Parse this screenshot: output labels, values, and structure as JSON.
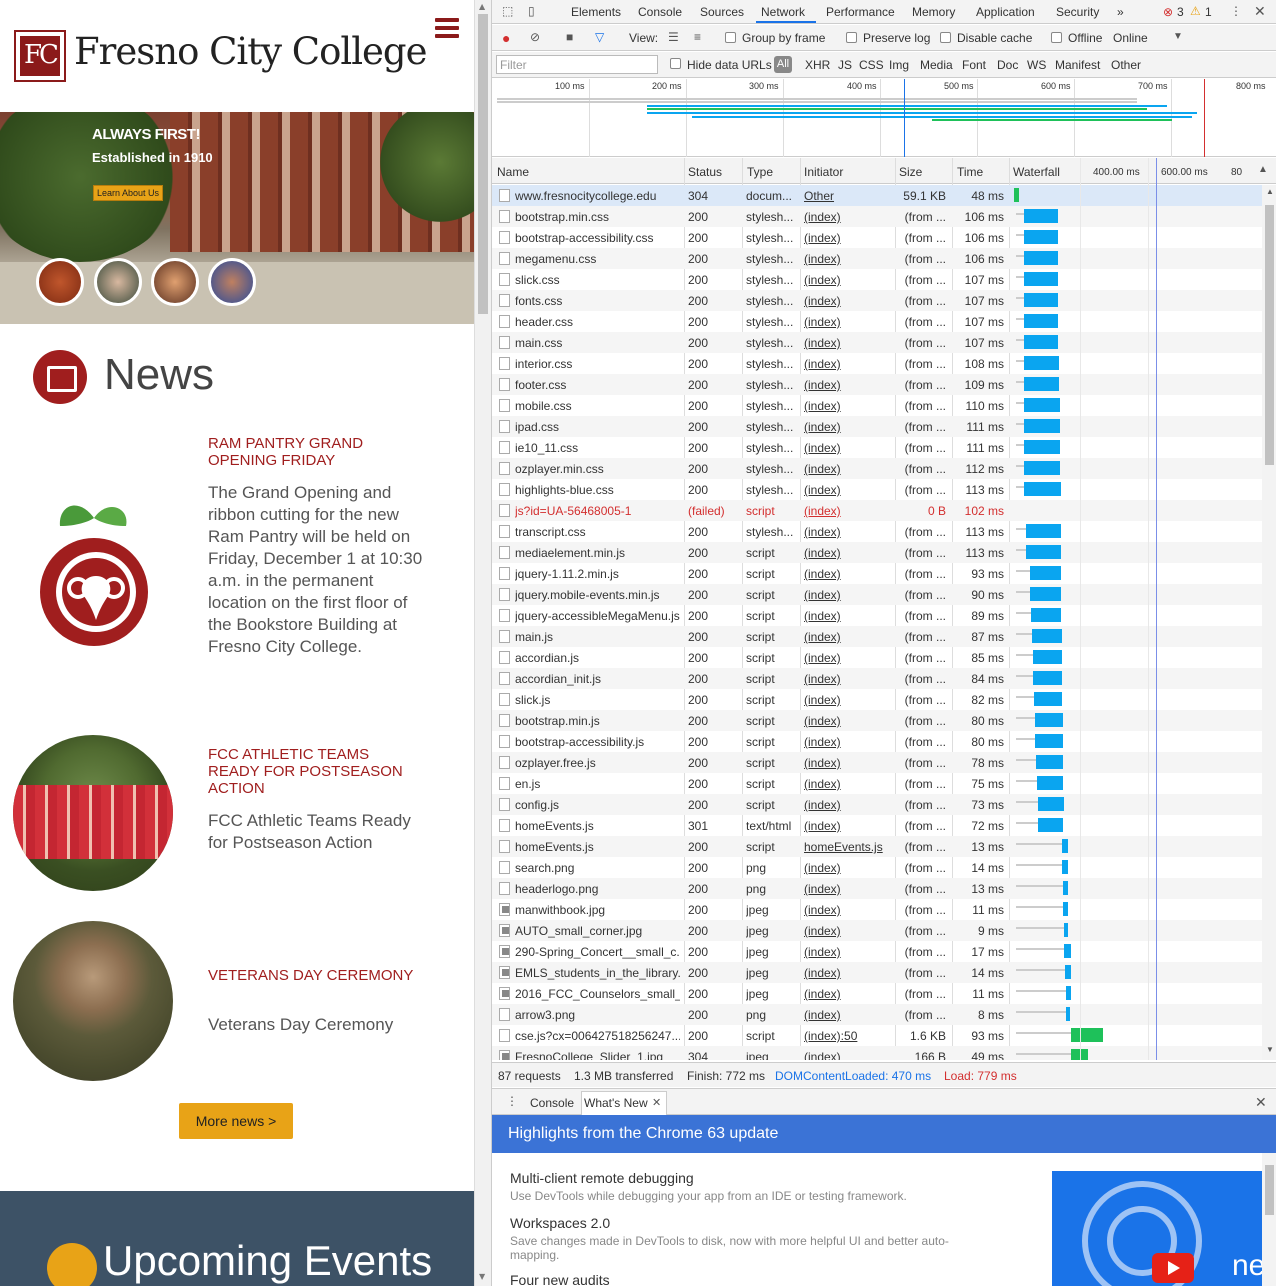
{
  "site": {
    "name": "Fresno City College",
    "hero": {
      "tagline": "ALWAYS FIRST!",
      "established": "Established in 1910",
      "learn_button": "Learn About Us"
    },
    "news_heading": "News",
    "news": [
      {
        "title": "RAM PANTRY GRAND OPENING FRIDAY",
        "text": "The Grand Opening and ribbon cutting for the new Ram Pantry will be held on Friday, December 1 at 10:30 a.m. in the permanent location on the first floor of the Bookstore Building at Fresno City College."
      },
      {
        "title": "FCC ATHLETIC TEAMS READY FOR POSTSEASON ACTION",
        "text": "FCC Athletic Teams Ready for Postseason Action"
      },
      {
        "title": "VETERANS DAY CEREMONY",
        "text": "Veterans Day Ceremony"
      }
    ],
    "more_news": "More news >",
    "events_heading": "Upcoming Events"
  },
  "devtools": {
    "tabs": [
      "Elements",
      "Console",
      "Sources",
      "Network",
      "Performance",
      "Memory",
      "Application",
      "Security"
    ],
    "active_tab": "Network",
    "more_tabs": "»",
    "errors": "3",
    "warnings": "1",
    "toolbar": {
      "view": "View:",
      "group_by_frame": "Group by frame",
      "preserve_log": "Preserve log",
      "disable_cache": "Disable cache",
      "offline": "Offline",
      "online": "Online"
    },
    "filter": {
      "placeholder": "Filter",
      "hide_data_urls": "Hide data URLs",
      "types": [
        "All",
        "XHR",
        "JS",
        "CSS",
        "Img",
        "Media",
        "Font",
        "Doc",
        "WS",
        "Manifest",
        "Other"
      ]
    },
    "overview_ticks": [
      "100 ms",
      "200 ms",
      "300 ms",
      "400 ms",
      "500 ms",
      "600 ms",
      "700 ms",
      "800 ms"
    ],
    "columns": {
      "name": "Name",
      "status": "Status",
      "type": "Type",
      "initiator": "Initiator",
      "size": "Size",
      "time": "Time",
      "waterfall": "Waterfall",
      "w1": "400.00 ms",
      "w2": "600.00 ms",
      "w3": "80"
    },
    "requests": [
      {
        "name": "www.fresnocitycollege.edu",
        "status": "304",
        "type": "docum...",
        "initiator": "Other",
        "size": "59.1 KB",
        "time": "48 ms",
        "wf_start": 0,
        "wf_len": 5,
        "wf_color": "#1ec15a",
        "icon": "doc"
      },
      {
        "name": "bootstrap.min.css",
        "status": "200",
        "type": "stylesh...",
        "initiator": "(index)",
        "size": "(from ...",
        "time": "106 ms",
        "wf_start": 10,
        "wf_len": 34,
        "wf_color": "#0aa5f0",
        "icon": "doc"
      },
      {
        "name": "bootstrap-accessibility.css",
        "status": "200",
        "type": "stylesh...",
        "initiator": "(index)",
        "size": "(from ...",
        "time": "106 ms",
        "wf_start": 10,
        "wf_len": 34,
        "wf_color": "#0aa5f0",
        "icon": "doc"
      },
      {
        "name": "megamenu.css",
        "status": "200",
        "type": "stylesh...",
        "initiator": "(index)",
        "size": "(from ...",
        "time": "106 ms",
        "wf_start": 10,
        "wf_len": 34,
        "wf_color": "#0aa5f0",
        "icon": "doc"
      },
      {
        "name": "slick.css",
        "status": "200",
        "type": "stylesh...",
        "initiator": "(index)",
        "size": "(from ...",
        "time": "107 ms",
        "wf_start": 10,
        "wf_len": 34,
        "wf_color": "#0aa5f0",
        "icon": "doc"
      },
      {
        "name": "fonts.css",
        "status": "200",
        "type": "stylesh...",
        "initiator": "(index)",
        "size": "(from ...",
        "time": "107 ms",
        "wf_start": 10,
        "wf_len": 34,
        "wf_color": "#0aa5f0",
        "icon": "doc"
      },
      {
        "name": "header.css",
        "status": "200",
        "type": "stylesh...",
        "initiator": "(index)",
        "size": "(from ...",
        "time": "107 ms",
        "wf_start": 10,
        "wf_len": 34,
        "wf_color": "#0aa5f0",
        "icon": "doc"
      },
      {
        "name": "main.css",
        "status": "200",
        "type": "stylesh...",
        "initiator": "(index)",
        "size": "(from ...",
        "time": "107 ms",
        "wf_start": 10,
        "wf_len": 34,
        "wf_color": "#0aa5f0",
        "icon": "doc"
      },
      {
        "name": "interior.css",
        "status": "200",
        "type": "stylesh...",
        "initiator": "(index)",
        "size": "(from ...",
        "time": "108 ms",
        "wf_start": 10,
        "wf_len": 35,
        "wf_color": "#0aa5f0",
        "icon": "doc"
      },
      {
        "name": "footer.css",
        "status": "200",
        "type": "stylesh...",
        "initiator": "(index)",
        "size": "(from ...",
        "time": "109 ms",
        "wf_start": 10,
        "wf_len": 35,
        "wf_color": "#0aa5f0",
        "icon": "doc"
      },
      {
        "name": "mobile.css",
        "status": "200",
        "type": "stylesh...",
        "initiator": "(index)",
        "size": "(from ...",
        "time": "110 ms",
        "wf_start": 10,
        "wf_len": 36,
        "wf_color": "#0aa5f0",
        "icon": "doc"
      },
      {
        "name": "ipad.css",
        "status": "200",
        "type": "stylesh...",
        "initiator": "(index)",
        "size": "(from ...",
        "time": "111 ms",
        "wf_start": 10,
        "wf_len": 36,
        "wf_color": "#0aa5f0",
        "icon": "doc"
      },
      {
        "name": "ie10_11.css",
        "status": "200",
        "type": "stylesh...",
        "initiator": "(index)",
        "size": "(from ...",
        "time": "111 ms",
        "wf_start": 10,
        "wf_len": 36,
        "wf_color": "#0aa5f0",
        "icon": "doc"
      },
      {
        "name": "ozplayer.min.css",
        "status": "200",
        "type": "stylesh...",
        "initiator": "(index)",
        "size": "(from ...",
        "time": "112 ms",
        "wf_start": 10,
        "wf_len": 36,
        "wf_color": "#0aa5f0",
        "icon": "doc"
      },
      {
        "name": "highlights-blue.css",
        "status": "200",
        "type": "stylesh...",
        "initiator": "(index)",
        "size": "(from ...",
        "time": "113 ms",
        "wf_start": 10,
        "wf_len": 37,
        "wf_color": "#0aa5f0",
        "icon": "doc"
      },
      {
        "name": "js?id=UA-56468005-1",
        "status": "(failed)",
        "type": "script",
        "initiator": "(index)",
        "size": "0 B",
        "time": "102 ms",
        "wf_start": 0,
        "wf_len": 0,
        "wf_color": "#0aa5f0",
        "icon": "doc",
        "failed": true
      },
      {
        "name": "transcript.css",
        "status": "200",
        "type": "stylesh...",
        "initiator": "(index)",
        "size": "(from ...",
        "time": "113 ms",
        "wf_start": 12,
        "wf_len": 35,
        "wf_color": "#0aa5f0",
        "icon": "doc"
      },
      {
        "name": "mediaelement.min.js",
        "status": "200",
        "type": "script",
        "initiator": "(index)",
        "size": "(from ...",
        "time": "113 ms",
        "wf_start": 12,
        "wf_len": 35,
        "wf_color": "#0aa5f0",
        "icon": "doc"
      },
      {
        "name": "jquery-1.11.2.min.js",
        "status": "200",
        "type": "script",
        "initiator": "(index)",
        "size": "(from ...",
        "time": "93 ms",
        "wf_start": 16,
        "wf_len": 31,
        "wf_color": "#0aa5f0",
        "icon": "doc"
      },
      {
        "name": "jquery.mobile-events.min.js",
        "status": "200",
        "type": "script",
        "initiator": "(index)",
        "size": "(from ...",
        "time": "90 ms",
        "wf_start": 16,
        "wf_len": 31,
        "wf_color": "#0aa5f0",
        "icon": "doc"
      },
      {
        "name": "jquery-accessibleMegaMenu.js",
        "status": "200",
        "type": "script",
        "initiator": "(index)",
        "size": "(from ...",
        "time": "89 ms",
        "wf_start": 17,
        "wf_len": 30,
        "wf_color": "#0aa5f0",
        "icon": "doc"
      },
      {
        "name": "main.js",
        "status": "200",
        "type": "script",
        "initiator": "(index)",
        "size": "(from ...",
        "time": "87 ms",
        "wf_start": 18,
        "wf_len": 30,
        "wf_color": "#0aa5f0",
        "icon": "doc"
      },
      {
        "name": "accordian.js",
        "status": "200",
        "type": "script",
        "initiator": "(index)",
        "size": "(from ...",
        "time": "85 ms",
        "wf_start": 19,
        "wf_len": 29,
        "wf_color": "#0aa5f0",
        "icon": "doc"
      },
      {
        "name": "accordian_init.js",
        "status": "200",
        "type": "script",
        "initiator": "(index)",
        "size": "(from ...",
        "time": "84 ms",
        "wf_start": 19,
        "wf_len": 29,
        "wf_color": "#0aa5f0",
        "icon": "doc"
      },
      {
        "name": "slick.js",
        "status": "200",
        "type": "script",
        "initiator": "(index)",
        "size": "(from ...",
        "time": "82 ms",
        "wf_start": 20,
        "wf_len": 28,
        "wf_color": "#0aa5f0",
        "icon": "doc"
      },
      {
        "name": "bootstrap.min.js",
        "status": "200",
        "type": "script",
        "initiator": "(index)",
        "size": "(from ...",
        "time": "80 ms",
        "wf_start": 21,
        "wf_len": 28,
        "wf_color": "#0aa5f0",
        "icon": "doc"
      },
      {
        "name": "bootstrap-accessibility.js",
        "status": "200",
        "type": "script",
        "initiator": "(index)",
        "size": "(from ...",
        "time": "80 ms",
        "wf_start": 21,
        "wf_len": 28,
        "wf_color": "#0aa5f0",
        "icon": "doc"
      },
      {
        "name": "ozplayer.free.js",
        "status": "200",
        "type": "script",
        "initiator": "(index)",
        "size": "(from ...",
        "time": "78 ms",
        "wf_start": 22,
        "wf_len": 27,
        "wf_color": "#0aa5f0",
        "icon": "doc"
      },
      {
        "name": "en.js",
        "status": "200",
        "type": "script",
        "initiator": "(index)",
        "size": "(from ...",
        "time": "75 ms",
        "wf_start": 23,
        "wf_len": 26,
        "wf_color": "#0aa5f0",
        "icon": "doc"
      },
      {
        "name": "config.js",
        "status": "200",
        "type": "script",
        "initiator": "(index)",
        "size": "(from ...",
        "time": "73 ms",
        "wf_start": 24,
        "wf_len": 26,
        "wf_color": "#0aa5f0",
        "icon": "doc"
      },
      {
        "name": "homeEvents.js",
        "status": "301",
        "type": "text/html",
        "initiator": "(index)",
        "size": "(from ...",
        "time": "72 ms",
        "wf_start": 24,
        "wf_len": 25,
        "wf_color": "#0aa5f0",
        "icon": "doc"
      },
      {
        "name": "homeEvents.js",
        "status": "200",
        "type": "script",
        "initiator": "homeEvents.js",
        "size": "(from ...",
        "time": "13 ms",
        "wf_start": 48,
        "wf_len": 6,
        "wf_color": "#0aa5f0",
        "icon": "doc"
      },
      {
        "name": "search.png",
        "status": "200",
        "type": "png",
        "initiator": "(index)",
        "size": "(from ...",
        "time": "14 ms",
        "wf_start": 48,
        "wf_len": 6,
        "wf_color": "#0aa5f0",
        "icon": "doc"
      },
      {
        "name": "headerlogo.png",
        "status": "200",
        "type": "png",
        "initiator": "(index)",
        "size": "(from ...",
        "time": "13 ms",
        "wf_start": 49,
        "wf_len": 5,
        "wf_color": "#0aa5f0",
        "icon": "doc"
      },
      {
        "name": "manwithbook.jpg",
        "status": "200",
        "type": "jpeg",
        "initiator": "(index)",
        "size": "(from ...",
        "time": "11 ms",
        "wf_start": 49,
        "wf_len": 5,
        "wf_color": "#0aa5f0",
        "icon": "img"
      },
      {
        "name": "AUTO_small_corner.jpg",
        "status": "200",
        "type": "jpeg",
        "initiator": "(index)",
        "size": "(from ...",
        "time": "9 ms",
        "wf_start": 50,
        "wf_len": 4,
        "wf_color": "#0aa5f0",
        "icon": "img"
      },
      {
        "name": "290-Spring_Concert__small_c...",
        "status": "200",
        "type": "jpeg",
        "initiator": "(index)",
        "size": "(from ...",
        "time": "17 ms",
        "wf_start": 50,
        "wf_len": 7,
        "wf_color": "#0aa5f0",
        "icon": "img"
      },
      {
        "name": "EMLS_students_in_the_library...",
        "status": "200",
        "type": "jpeg",
        "initiator": "(index)",
        "size": "(from ...",
        "time": "14 ms",
        "wf_start": 51,
        "wf_len": 6,
        "wf_color": "#0aa5f0",
        "icon": "img"
      },
      {
        "name": "2016_FCC_Counselors_small_...",
        "status": "200",
        "type": "jpeg",
        "initiator": "(index)",
        "size": "(from ...",
        "time": "11 ms",
        "wf_start": 52,
        "wf_len": 5,
        "wf_color": "#0aa5f0",
        "icon": "img"
      },
      {
        "name": "arrow3.png",
        "status": "200",
        "type": "png",
        "initiator": "(index)",
        "size": "(from ...",
        "time": "8 ms",
        "wf_start": 52,
        "wf_len": 4,
        "wf_color": "#0aa5f0",
        "icon": "doc"
      },
      {
        "name": "cse.js?cx=006427518256247...",
        "status": "200",
        "type": "script",
        "initiator": "(index):50",
        "size": "1.6 KB",
        "time": "93 ms",
        "wf_start": 57,
        "wf_len": 32,
        "wf_color": "#1ec15a",
        "icon": "doc"
      },
      {
        "name": "FresnoCollege_Slider_1.jpg",
        "status": "304",
        "type": "jpeg",
        "initiator": "(index)",
        "size": "166 B",
        "time": "49 ms",
        "wf_start": 57,
        "wf_len": 17,
        "wf_color": "#1ec15a",
        "icon": "img"
      }
    ],
    "summary": {
      "requests": "87 requests",
      "transferred": "1.3 MB transferred",
      "finish": "Finish: 772 ms",
      "dcl": "DOMContentLoaded: 470 ms",
      "load": "Load: 779 ms"
    },
    "colors": {
      "dcl": "#1a73e8",
      "load": "#d32f2f",
      "accent": "#1a73e8"
    },
    "drawer": {
      "tabs": [
        "Console",
        "What's New"
      ],
      "banner": "Highlights from the Chrome 63 update"
    },
    "whats_new": [
      {
        "title": "Multi-client remote debugging",
        "text": "Use DevTools while debugging your app from an IDE or testing framework."
      },
      {
        "title": "Workspaces 2.0",
        "text": "Save changes made in DevTools to disk, now with more helpful UI and better auto-mapping."
      },
      {
        "title": "Four new audits",
        "text": ""
      }
    ],
    "promo_text": "ne"
  }
}
